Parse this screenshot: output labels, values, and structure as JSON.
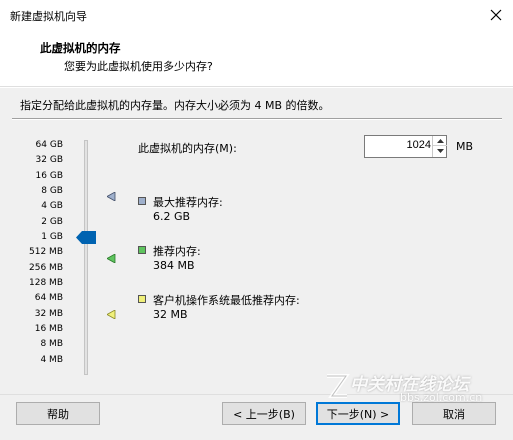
{
  "window": {
    "title": "新建虚拟机向导"
  },
  "header": {
    "title": "此虚拟机的内存",
    "subtitle": "您要为此虚拟机使用多少内存?"
  },
  "instructions": "指定分配给此虚拟机的内存量。内存大小必须为 4 MB 的倍数。",
  "memory": {
    "label": "此虚拟机的内存(M):",
    "value": "1024",
    "unit": "MB",
    "scale": [
      "64 GB",
      "32 GB",
      "16 GB",
      "8 GB",
      "4 GB",
      "2 GB",
      "1 GB",
      "512 MB",
      "256 MB",
      "128 MB",
      "64 MB",
      "32 MB",
      "16 MB",
      "8 MB",
      "4 MB"
    ],
    "selected_index": 6
  },
  "legend": [
    {
      "title": "最大推荐内存:",
      "value": "6.2 GB",
      "color": "#9fb0cc"
    },
    {
      "title": "推荐内存:",
      "value": "384 MB",
      "color": "#5ec45e"
    },
    {
      "title": "客户机操作系统最低推荐内存:",
      "value": "32 MB",
      "color": "#f0f07a"
    }
  ],
  "buttons": {
    "help": "帮助",
    "back": "< 上一步(B)",
    "next": "下一步(N) >",
    "cancel": "取消"
  },
  "watermark": {
    "main": "中关村在线论坛",
    "sub": "bbs.zol.com.cn"
  },
  "colors": {
    "thumb": "#0063b1",
    "default_button_border": "#0078d7"
  }
}
